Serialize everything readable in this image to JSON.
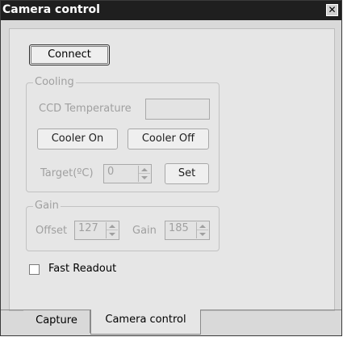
{
  "window": {
    "title": "Camera control",
    "close_glyph": "✕"
  },
  "connect": {
    "label": "Connect"
  },
  "cooling": {
    "legend": "Cooling",
    "ccd_temperature_label": "CCD Temperature",
    "ccd_temperature_value": "",
    "cooler_on_label": "Cooler On",
    "cooler_off_label": "Cooler Off",
    "target_label": "Target(ºC)",
    "target_value": "0",
    "set_label": "Set"
  },
  "gain": {
    "legend": "Gain",
    "offset_label": "Offset",
    "offset_value": "127",
    "gain_label": "Gain",
    "gain_value": "185"
  },
  "fast_readout": {
    "label": "Fast Readout",
    "checked": false
  },
  "tabs": [
    {
      "label": "Capture",
      "active": false
    },
    {
      "label": "Camera control",
      "active": true
    }
  ]
}
